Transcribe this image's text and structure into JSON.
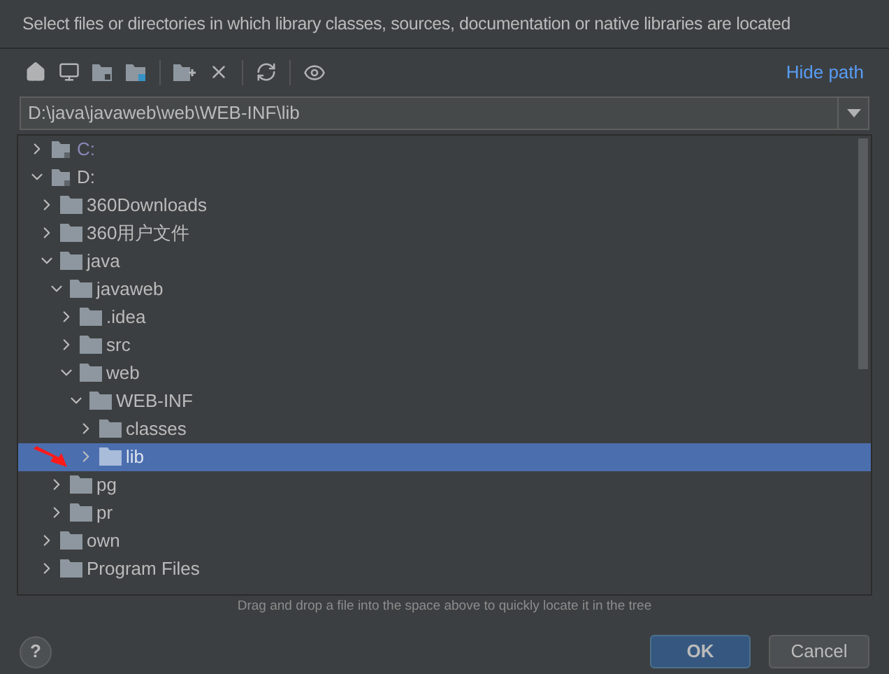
{
  "description": "Select files or directories in which library classes, sources, documentation or native libraries are located",
  "toolbar": {
    "link": "Hide path"
  },
  "path_field": {
    "value": "D:\\java\\javaweb\\web\\WEB-INF\\lib"
  },
  "tree": [
    {
      "label": "C:",
      "kind": "drive",
      "available": false,
      "expanded": false,
      "selected": false
    },
    {
      "label": "D:",
      "kind": "drive",
      "available": true,
      "expanded": true,
      "selected": false,
      "children": [
        {
          "label": "360Downloads",
          "kind": "folder",
          "expanded": false,
          "selected": false
        },
        {
          "label": "360用户文件",
          "kind": "folder",
          "expanded": false,
          "selected": false
        },
        {
          "label": "java",
          "kind": "folder",
          "expanded": true,
          "selected": false,
          "children": [
            {
              "label": "javaweb",
              "kind": "folder",
              "expanded": true,
              "selected": false,
              "children": [
                {
                  "label": ".idea",
                  "kind": "folder",
                  "expanded": false,
                  "selected": false
                },
                {
                  "label": "src",
                  "kind": "folder",
                  "expanded": false,
                  "selected": false
                },
                {
                  "label": "web",
                  "kind": "folder",
                  "expanded": true,
                  "selected": false,
                  "children": [
                    {
                      "label": "WEB-INF",
                      "kind": "folder",
                      "expanded": true,
                      "selected": false,
                      "children": [
                        {
                          "label": "classes",
                          "kind": "folder",
                          "expanded": false,
                          "selected": false
                        },
                        {
                          "label": "lib",
                          "kind": "folder",
                          "expanded": false,
                          "selected": true
                        }
                      ]
                    }
                  ]
                }
              ]
            },
            {
              "label": "pg",
              "kind": "folder",
              "expanded": false,
              "selected": false
            },
            {
              "label": "pr",
              "kind": "folder",
              "expanded": false,
              "selected": false
            }
          ]
        },
        {
          "label": "own",
          "kind": "folder",
          "expanded": false,
          "selected": false
        },
        {
          "label": "Program Files",
          "kind": "folder",
          "expanded": false,
          "selected": false
        }
      ]
    }
  ],
  "hint": "Drag and drop a file into the space above to quickly locate it in the tree",
  "help": "?",
  "buttons": [
    {
      "label": "OK",
      "kind": "primary"
    },
    {
      "label": "Cancel",
      "kind": "secondary"
    }
  ]
}
